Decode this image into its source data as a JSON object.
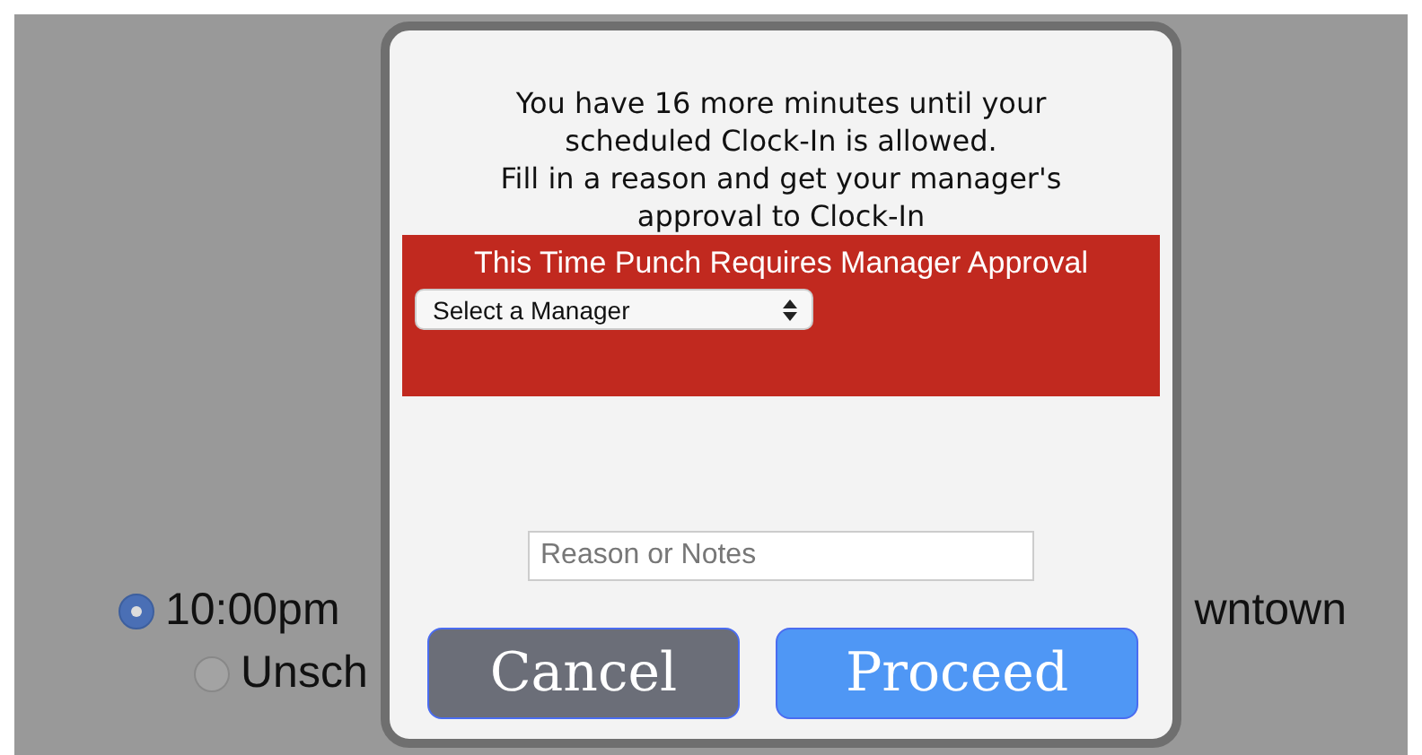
{
  "background": {
    "shifts": [
      {
        "time": "10:00pm",
        "trailing": "wntown",
        "selected": true
      },
      {
        "time": "Unsch",
        "selected": false
      }
    ]
  },
  "dialog": {
    "message": [
      "You have 16 more minutes until your scheduled Clock-In is allowed.",
      "Fill in a reason and get your manager's approval to Clock-In"
    ],
    "banner": {
      "title": "This Time Punch Requires Manager Approval",
      "select": "Select a Manager"
    },
    "reason": {
      "placeholder": "Reason or Notes"
    },
    "buttons": [
      {
        "label": "Cancel",
        "kind": "secondary"
      },
      {
        "label": "Proceed",
        "kind": "primary"
      }
    ]
  }
}
